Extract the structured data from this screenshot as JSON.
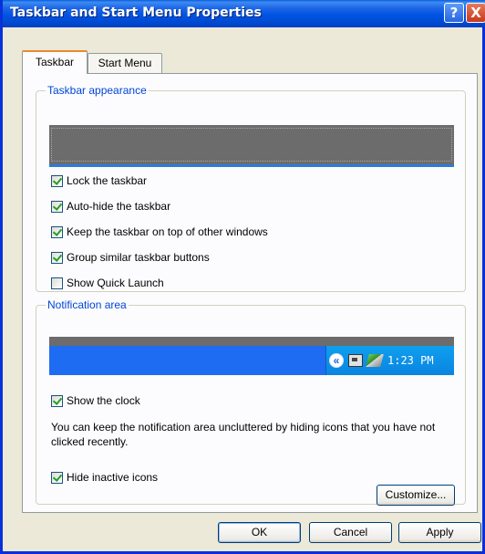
{
  "window": {
    "title": "Taskbar and Start Menu Properties",
    "help_glyph": "?",
    "close_glyph": "X"
  },
  "tabs": [
    {
      "label": "Taskbar",
      "active": true
    },
    {
      "label": "Start Menu",
      "active": false
    }
  ],
  "appearance": {
    "legend": "Taskbar appearance",
    "options": [
      {
        "label": "Lock the taskbar",
        "checked": true
      },
      {
        "label": "Auto-hide the taskbar",
        "checked": true
      },
      {
        "label": "Keep the taskbar on top of other windows",
        "checked": true
      },
      {
        "label": "Group similar taskbar buttons",
        "checked": true
      },
      {
        "label": "Show Quick Launch",
        "checked": false
      }
    ]
  },
  "notification": {
    "legend": "Notification area",
    "chevron_glyph": "«",
    "tray_icons": [
      "network-icon",
      "display-icon"
    ],
    "clock_time": "1:23 PM",
    "show_clock": {
      "label": "Show the clock",
      "checked": true
    },
    "description": "You can keep the notification area uncluttered by hiding icons that you have not clicked recently.",
    "hide_inactive": {
      "label": "Hide inactive icons",
      "checked": true
    },
    "customize_label": "Customize..."
  },
  "buttons": {
    "ok": "OK",
    "cancel": "Cancel",
    "apply": "Apply"
  },
  "colors": {
    "title_bar": "#0054e3",
    "legend_text": "#0046d5",
    "active_tab_accent": "#e68b2c",
    "check_mark": "#21a121",
    "taskbar_blue": "#1e6cf1"
  }
}
